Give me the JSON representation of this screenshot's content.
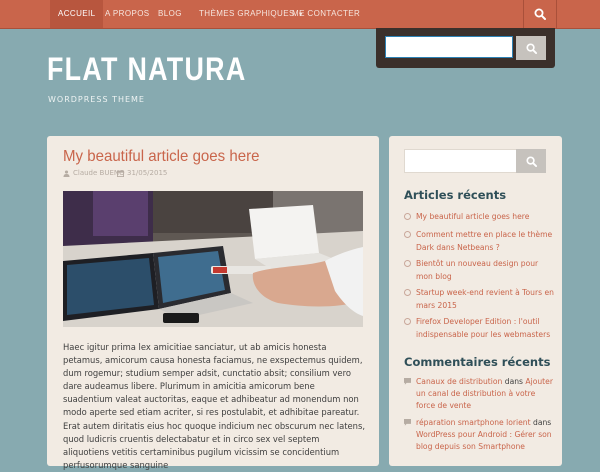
{
  "nav": {
    "items": [
      {
        "label": "ACCUEIL"
      },
      {
        "label": "A PROPOS"
      },
      {
        "label": "BLOG"
      },
      {
        "label": "THÈMES GRAPHIQUES"
      },
      {
        "label": "ME CONTACTER"
      }
    ],
    "search_icon": "search-icon"
  },
  "site": {
    "title": "FLAT NATURA",
    "description": "WORDPRESS THEME"
  },
  "article": {
    "title": "My beautiful article goes here",
    "author": "Claude BUENO",
    "date": "31/05/2015",
    "paragraph1": "Haec igitur prima lex amicitiae sanciatur, ut ab amicis honesta petamus, amicorum causa honesta faciamus, ne exspectemus quidem, dum rogemur; studium semper adsit, cunctatio absit; consilium vero dare audeamus libere. Plurimum in amicitia amicorum bene suadentium valeat auctoritas, eaque et adhibeatur ad monendum non modo aperte sed etiam acriter, si res postulabit, et adhibitae pareatur.",
    "paragraph2": "Erat autem diritatis eius hoc quoque indicium nec obscurum nec latens, quod ludicris cruentis delectabatur et in circo sex vel septem aliquotiens vetitis certaminibus pugilum vicissim se concidentium perfusorumque sanguine"
  },
  "sidebar": {
    "recent_title": "Articles récents",
    "recent": [
      "My beautiful article goes here",
      "Comment mettre en place le thème Dark dans Netbeans ?",
      "Bientôt un nouveau design pour mon blog",
      "Startup week-end revient à Tours en mars 2015",
      "Firefox Developer Edition : l'outil indispensable pour les webmasters"
    ],
    "comments_title": "Commentaires récents",
    "comments": [
      {
        "author": "Canaux de distribution",
        "joiner": "dans",
        "post": "Ajouter un canal de distribution à votre force de vente"
      },
      {
        "author": "réparation smartphone lorient",
        "joiner": "dans",
        "post": "WordPress pour Android : Gérer son blog depuis son Smartphone"
      }
    ]
  },
  "colors": {
    "nav": "#c9654b",
    "background": "#87aab0",
    "card": "#f2ebe3",
    "accent": "#c9654b",
    "heading": "#2f4f58"
  }
}
